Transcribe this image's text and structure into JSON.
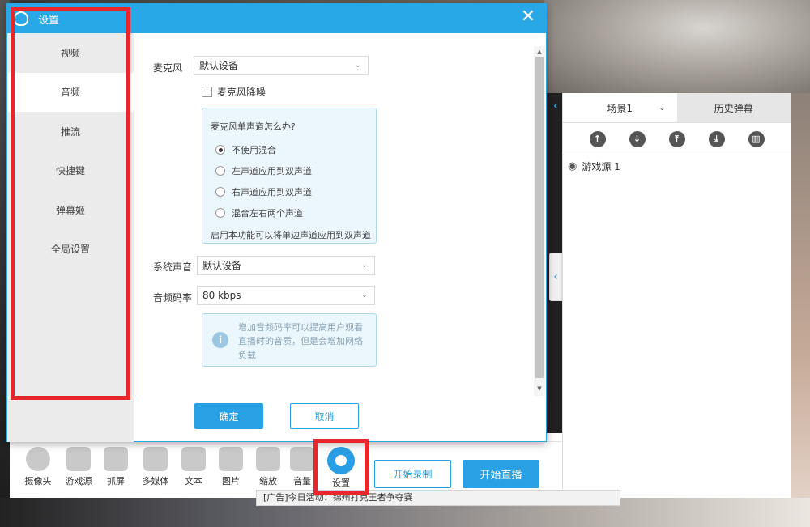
{
  "dialog": {
    "title": "设置",
    "close": "✕",
    "nav": [
      {
        "label": "视频"
      },
      {
        "label": "音频"
      },
      {
        "label": "推流"
      },
      {
        "label": "快捷键"
      },
      {
        "label": "弹幕姬"
      },
      {
        "label": "全局设置"
      }
    ],
    "active_nav": "音频",
    "mic_label": "麦克风",
    "mic_value": "默认设备",
    "noise_label": "麦克风降噪",
    "mono_question": "麦克风单声道怎么办?",
    "mono_options": [
      {
        "label": "不使用混合",
        "checked": true
      },
      {
        "label": "左声道应用到双声道",
        "checked": false
      },
      {
        "label": "右声道应用到双声道",
        "checked": false
      },
      {
        "label": "混合左右两个声道",
        "checked": false
      }
    ],
    "mono_hint": "启用本功能可以将单边声道应用到双声道",
    "system_sound_label": "系统声音",
    "system_sound_value": "默认设备",
    "bitrate_label": "音频码率",
    "bitrate_value": "80 kbps",
    "info_text": "增加音频码率可以提高用户观看直播时的音质，但是会增加网络负载",
    "ok_label": "确定",
    "cancel_label": "取消"
  },
  "scene_panel": {
    "scene_tab": "场景1",
    "history_tab": "历史弹幕",
    "source_name": "游戏源 1",
    "tools": [
      "arrow-up-icon",
      "arrow-down-icon",
      "move-top-icon",
      "move-bottom-icon",
      "trash-icon"
    ]
  },
  "toolbar": {
    "items": [
      {
        "label": "摄像头",
        "icon": "camera-icon"
      },
      {
        "label": "游戏源",
        "icon": "gamepad-icon"
      },
      {
        "label": "抓屏",
        "icon": "screen-capture-icon"
      },
      {
        "label": "多媒体",
        "icon": "video-camera-icon"
      },
      {
        "label": "文本",
        "icon": "text-doc-icon"
      },
      {
        "label": "图片",
        "icon": "image-icon"
      },
      {
        "label": "缩放",
        "icon": "expand-icon"
      },
      {
        "label": "音量",
        "icon": "speaker-icon"
      },
      {
        "label": "设置",
        "icon": "gear-icon"
      }
    ],
    "record_label": "开始录制",
    "live_label": "开始直播"
  },
  "ad_text": "[广告]今日活动：锦州打克王者争夺赛",
  "colors": {
    "accent": "#29a8e8",
    "highlight": "#e8262c"
  }
}
